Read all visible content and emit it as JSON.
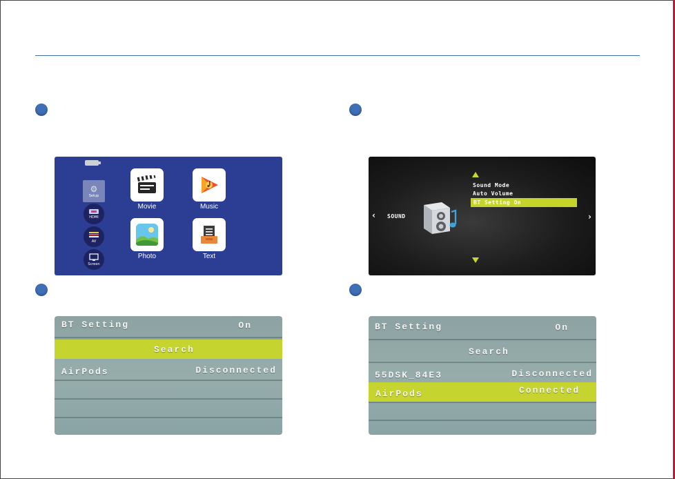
{
  "step_markers": {
    "color": "#3f6fb6"
  },
  "home": {
    "sources": [
      {
        "label": "Setup",
        "icon": "gear-icon"
      },
      {
        "label": "HDMI",
        "icon": "hdmi-icon"
      },
      {
        "label": "AV",
        "icon": "av-cable-icon"
      },
      {
        "label": "Screen",
        "icon": "screen-mirror-icon"
      }
    ],
    "apps": [
      {
        "label": "Movie",
        "icon": "clapperboard-icon"
      },
      {
        "label": "Music",
        "icon": "music-play-icon"
      },
      {
        "label": "Photo",
        "icon": "photo-landscape-icon"
      },
      {
        "label": "Text",
        "icon": "document-tray-icon"
      }
    ]
  },
  "sound_menu": {
    "section_label": "SOUND",
    "items": [
      "Sound Mode",
      "Auto Volume",
      "BT Setting On"
    ],
    "selected_index": 2,
    "accent": "#c8d72b"
  },
  "bt_before": {
    "title": "BT  Setting",
    "status": "On",
    "search_label": "Search",
    "devices": [
      {
        "name": "AirPods",
        "state": "Disconnected"
      }
    ]
  },
  "bt_after": {
    "title": "BT  Setting",
    "status": "On",
    "search_label": "Search",
    "devices": [
      {
        "name": "55DSK_84E3",
        "state": "Disconnected"
      },
      {
        "name": "AirPods",
        "state": "Connected"
      }
    ]
  },
  "highlight_color": "#c5d42e"
}
